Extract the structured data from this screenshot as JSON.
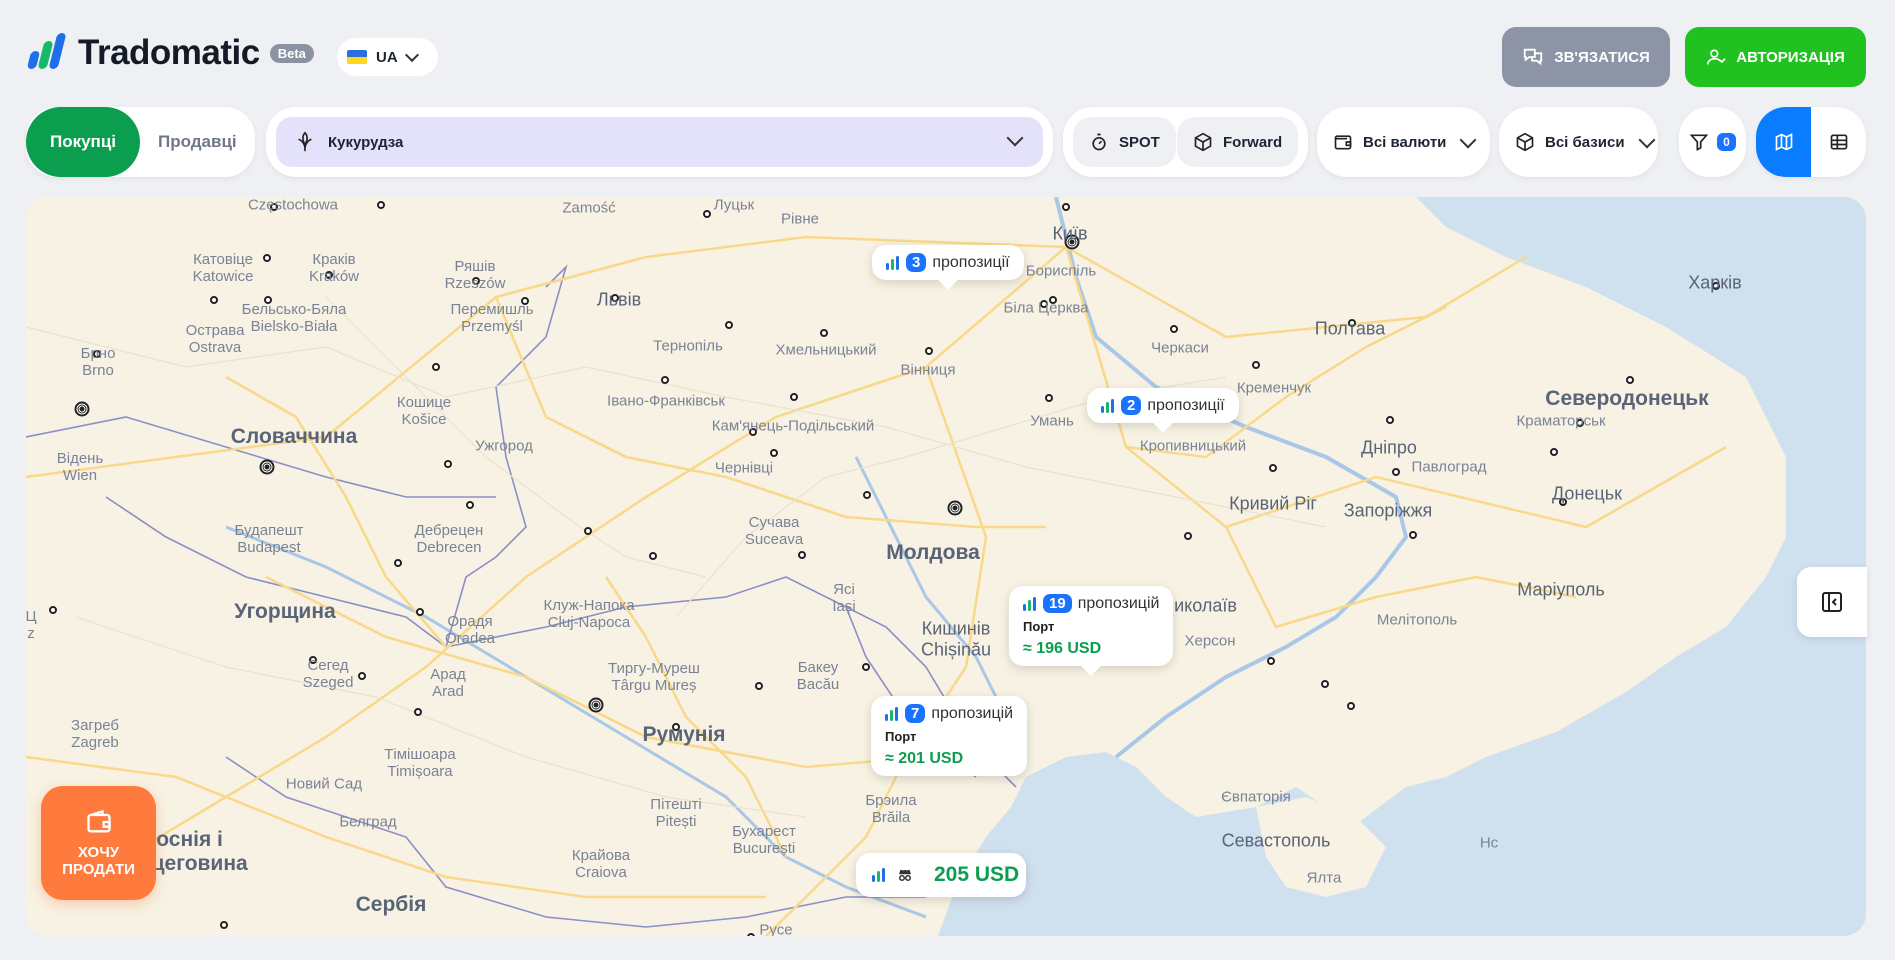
{
  "header": {
    "logo_text": "Tradomatic",
    "beta": "Beta",
    "language": "UA",
    "contact_label": "ЗВ'ЯЗАТИСЯ",
    "auth_label": "АВТОРИЗАЦІЯ"
  },
  "filters": {
    "role_active": "Покупці",
    "role_other": "Продавці",
    "crop": "Кукурудза",
    "type_spot": "SPOT",
    "type_forward": "Forward",
    "currencies": "Всі валюти",
    "bases": "Всі базиси",
    "filter_count": "0"
  },
  "map": {
    "cities": [
      {
        "name": "Częstochowa"
      },
      {
        "name": "Zamość"
      },
      {
        "name": "Луцьк"
      },
      {
        "name": "Рівне"
      },
      {
        "name": "Київ"
      },
      {
        "name": "Катовіце\nKatowice"
      },
      {
        "name": "Краків\nKraków"
      },
      {
        "name": "Ряшів\nRzeszów"
      },
      {
        "name": "Бориспіль"
      },
      {
        "name": "Харків"
      },
      {
        "name": "Остpава\nOstrava"
      },
      {
        "name": "Бельсько-Бяла\nBielsko-Biała"
      },
      {
        "name": "Перемишль\nPrzemyśl"
      },
      {
        "name": "Львів"
      },
      {
        "name": "Біла Церква"
      },
      {
        "name": "Полтава"
      },
      {
        "name": "Брно\nBrno"
      },
      {
        "name": "Тернопіль"
      },
      {
        "name": "Хмельницький"
      },
      {
        "name": "Черкаси"
      },
      {
        "name": "Вінниця"
      },
      {
        "name": "Кременчук"
      },
      {
        "name": "Кошице\nKošice"
      },
      {
        "name": "Івано-Франківськ"
      },
      {
        "name": "Северодонецьк"
      },
      {
        "name": "Словаччина"
      },
      {
        "name": "Кам'янець-Подільський"
      },
      {
        "name": "Умань"
      },
      {
        "name": "Краматорськ"
      },
      {
        "name": "Ужгород"
      },
      {
        "name": "Кропивницький"
      },
      {
        "name": "Дніпро"
      },
      {
        "name": "Павлоград"
      },
      {
        "name": "Відень\nWien"
      },
      {
        "name": "Чернівці"
      },
      {
        "name": "Кривий Ріг"
      },
      {
        "name": "Донецьк"
      },
      {
        "name": "Запоріжжя"
      },
      {
        "name": "Сучава\nSuceava"
      },
      {
        "name": "Будапешт\nBudapest"
      },
      {
        "name": "Дебрецен\nDebrecen"
      },
      {
        "name": "Молдова"
      },
      {
        "name": "Маріуполь"
      },
      {
        "name": "Ясі\nIași"
      },
      {
        "name": "Угорщина"
      },
      {
        "name": "Клуж-Напока\nCluj-Napoca"
      },
      {
        "name": "Кишинів\nChișinău"
      },
      {
        "name": "Миколаїв"
      },
      {
        "name": "Мелітополь"
      },
      {
        "name": "Орадя\nOradea"
      },
      {
        "name": "Херсон"
      },
      {
        "name": "Сегед\nSzeged"
      },
      {
        "name": "Тиргу-Муреш\nTârgu Mureș"
      },
      {
        "name": "Бакеу\nBacău"
      },
      {
        "name": "Арад\nArad"
      },
      {
        "name": "Загреб\nZagreb"
      },
      {
        "name": "Румунія"
      },
      {
        "name": "Тімішоара\nTimișoara"
      },
      {
        "name": "Новий Сад"
      },
      {
        "name": "Брэила\nBrăila"
      },
      {
        "name": "Євпаторія"
      },
      {
        "name": "Пітешті\nPitești"
      },
      {
        "name": "Белград"
      },
      {
        "name": "Бухарест\nBucurești"
      },
      {
        "name": "Севастополь"
      },
      {
        "name": "Боснія і\nГерцеговина"
      },
      {
        "name": "Крайова\nCraiova"
      },
      {
        "name": "Ялта"
      },
      {
        "name": "Сербія"
      },
      {
        "name": "Русе"
      },
      {
        "name": "Нс"
      },
      {
        "name": "Ц\nz"
      }
    ],
    "markers": [
      {
        "count": "3",
        "label": "пропозиції"
      },
      {
        "count": "2",
        "label": "пропозиції"
      },
      {
        "count": "19",
        "label": "пропозицій",
        "port": "Порт",
        "price": "≈ 196 USD"
      },
      {
        "count": "7",
        "label": "пропозицій",
        "port": "Порт",
        "price": "≈ 201 USD"
      }
    ],
    "price_chip": "205 USD"
  },
  "sell_button": "ХОЧУ\nПРОДАТИ",
  "colors": {
    "brand_green": "#1fc21f",
    "buyers_green": "#0b9e4f",
    "accent_blue": "#0a7cff",
    "sell_orange": "#ff7a3d",
    "crop_bg": "#e4e1fb"
  }
}
